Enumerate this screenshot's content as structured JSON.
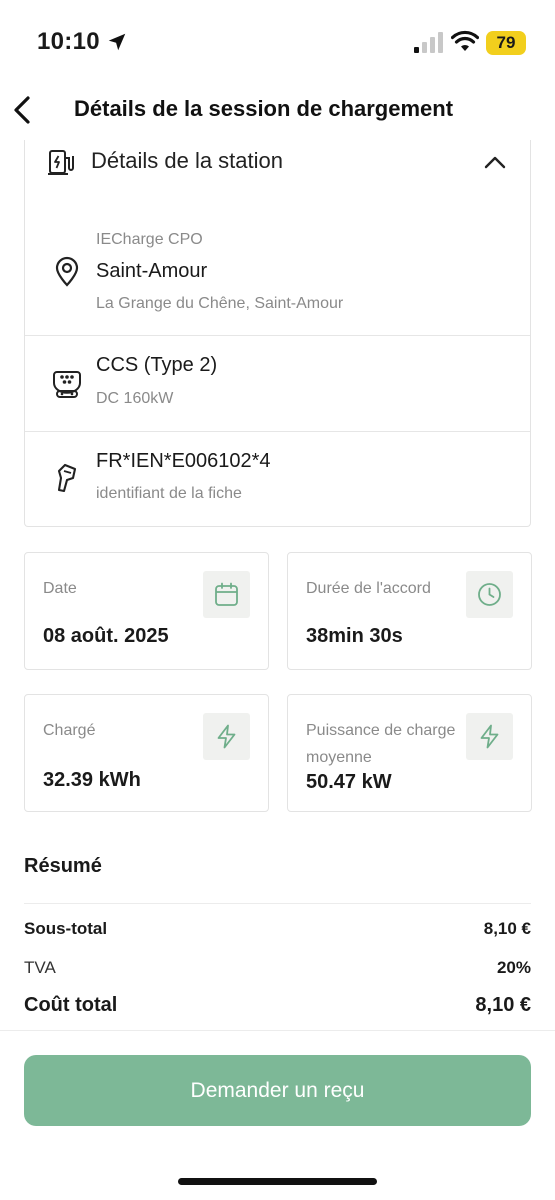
{
  "status_bar": {
    "time": "10:10",
    "battery": "79",
    "battery_color": "#f2cf1d",
    "icons": [
      "location-arrow-icon",
      "cellular-signal-icon",
      "wifi-icon",
      "battery-icon"
    ]
  },
  "header": {
    "title": "Détails de la session de chargement",
    "back_icon": "chevron-left-icon"
  },
  "station": {
    "section_title": "Détails de la station",
    "section_icon": "charging-station-icon",
    "collapse_icon": "chevron-up-icon",
    "location": {
      "operator": "IECharge CPO",
      "name": "Saint-Amour",
      "address": "La Grange du Chêne, Saint-Amour",
      "icon": "map-pin-icon"
    },
    "connector": {
      "type": "CCS (Type 2)",
      "power": "DC 160kW",
      "icon": "ccs-connector-icon"
    },
    "plug": {
      "id": "FR*IEN*E006102*4",
      "label": "identifiant de la fiche",
      "icon": "plug-icon"
    }
  },
  "stats": {
    "date": {
      "label": "Date",
      "value": "08 août. 2025",
      "icon": "calendar-icon"
    },
    "duration": {
      "label": "Durée de l'accord",
      "value": "38min 30s",
      "icon": "clock-icon"
    },
    "charged": {
      "label": "Chargé",
      "value": "32.39 kWh",
      "icon": "lightning-icon"
    },
    "avg_power": {
      "label": "Puissance de charge moyenne",
      "value": "50.47 kW",
      "icon": "lightning-icon"
    }
  },
  "summary": {
    "title": "Résumé",
    "subtotal_label": "Sous-total",
    "subtotal_value": "8,10 €",
    "vat_label": "TVA",
    "vat_value": "20%",
    "total_label": "Coût total",
    "total_value": "8,10 €"
  },
  "actions": {
    "receipt_button": "Demander un reçu",
    "button_color": "#7db897"
  },
  "theme": {
    "accent": "#7db897",
    "icon_green": "#6fae8a"
  }
}
